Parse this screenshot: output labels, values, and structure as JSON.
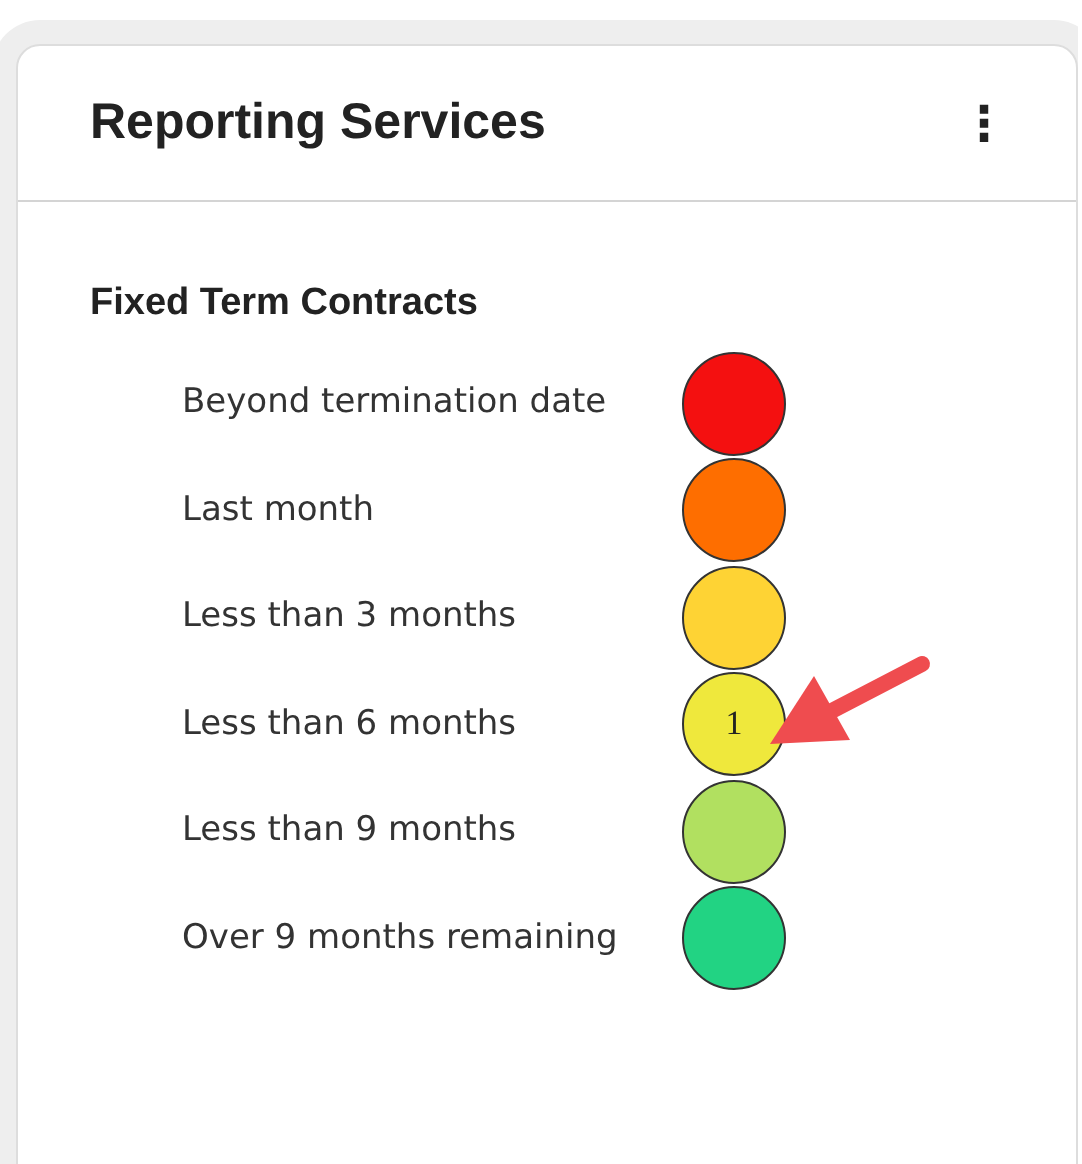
{
  "card": {
    "title": "Reporting Services",
    "menu_icon": "⋮"
  },
  "section": {
    "title": "Fixed Term Contracts"
  },
  "rows": [
    {
      "label": "Beyond termination date",
      "color": "#f41010"
    },
    {
      "label": "Last month",
      "color": "#fe6e00"
    },
    {
      "label": "Less than 3 months",
      "color": "#fed334"
    },
    {
      "label": "Less than 6 months",
      "color": "#efe83c",
      "count": "1",
      "highlighted": true
    },
    {
      "label": "Less than 9 months",
      "color": "#b1e060"
    },
    {
      "label": "Over 9 months remaining",
      "color": "#22d383"
    }
  ]
}
